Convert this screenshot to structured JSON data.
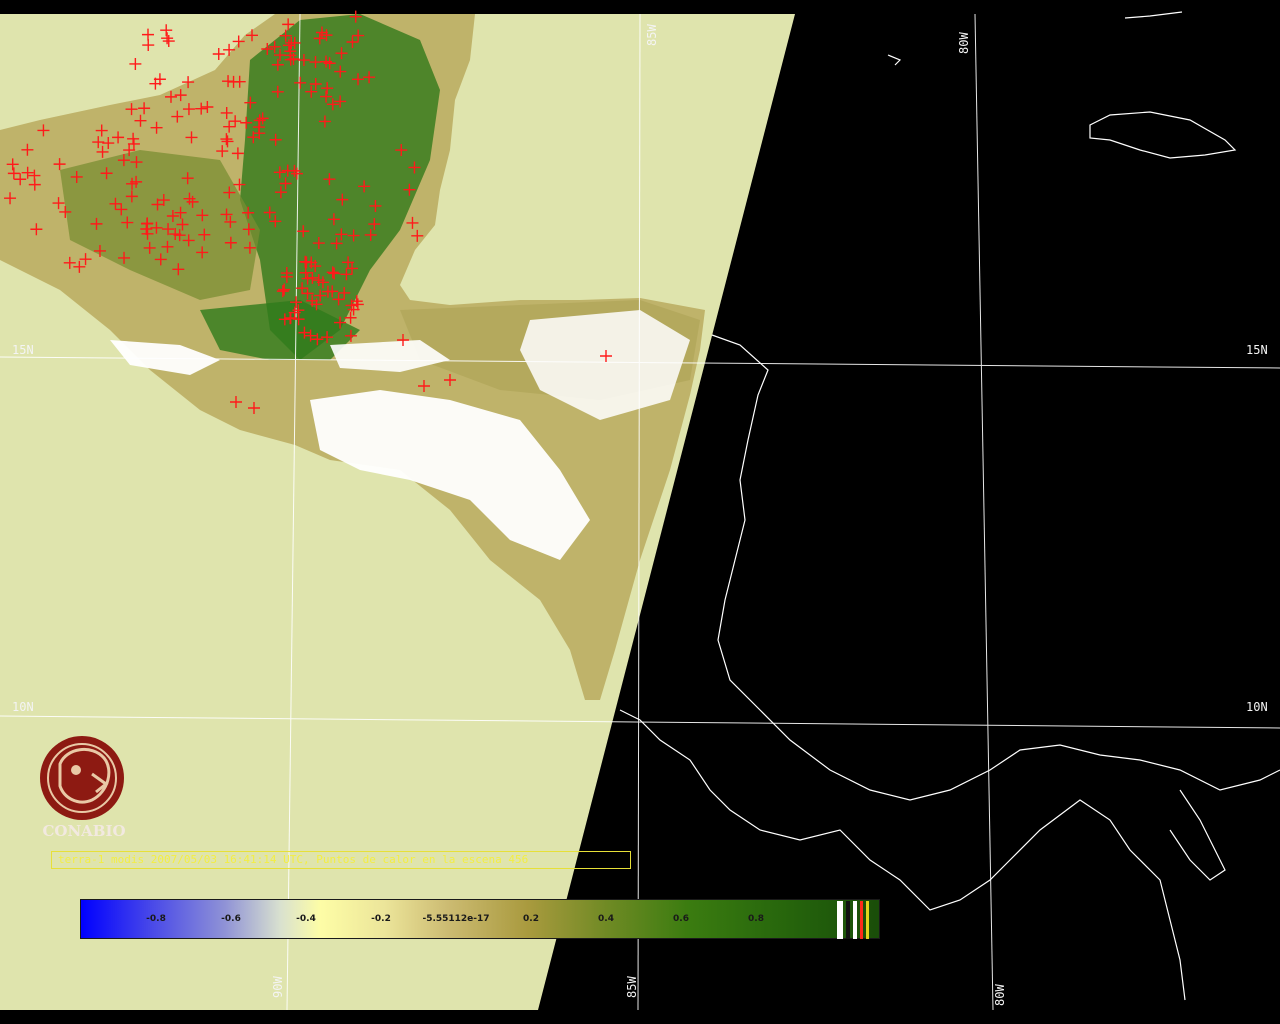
{
  "colors": {
    "background": "#000000",
    "ocean_swath": "#dfe4ad",
    "vegetation_dense": "#2f7a1c",
    "vegetation_mid": "#8f8f3a",
    "vegetation_sparse": "#c4bb72",
    "cloud": "#ffffff",
    "fire_marker": "#ff1a1a",
    "coastline_night": "#ffffff",
    "gridline": "#ffffff",
    "caption_text": "#f3ee44",
    "logo": "#8d1a12"
  },
  "grid_labels": {
    "lat_15_left": "15N",
    "lat_15_right": "15N",
    "lat_10_left": "10N",
    "lat_10_right": "10N",
    "lon_85_top": "85W",
    "lon_80_top": "80W",
    "lon_90_bottom": "90W",
    "lon_85_bottom": "85W",
    "lon_80_bottom": "80W"
  },
  "logo": {
    "icon": "conabio-seal-icon",
    "text": "CONABIO"
  },
  "caption": "terra-1 modis 2007/05/03 16:41:14 UTC, Puntos de calor en la escena 456",
  "colorbar": {
    "ticks": [
      "-0.8",
      "-0.6",
      "-0.4",
      "-0.2",
      "-5.55112e-17",
      "0.2",
      "0.4",
      "0.6",
      "0.8"
    ],
    "tick_values": [
      -0.8,
      -0.6,
      -0.4,
      -0.2,
      0.0,
      0.2,
      0.4,
      0.6,
      0.8
    ],
    "range": [
      -1.0,
      1.0
    ],
    "special_classes": [
      "#ffffff",
      "#111111",
      "#ffffff",
      "#ff2b1a",
      "#e3d51b"
    ]
  }
}
